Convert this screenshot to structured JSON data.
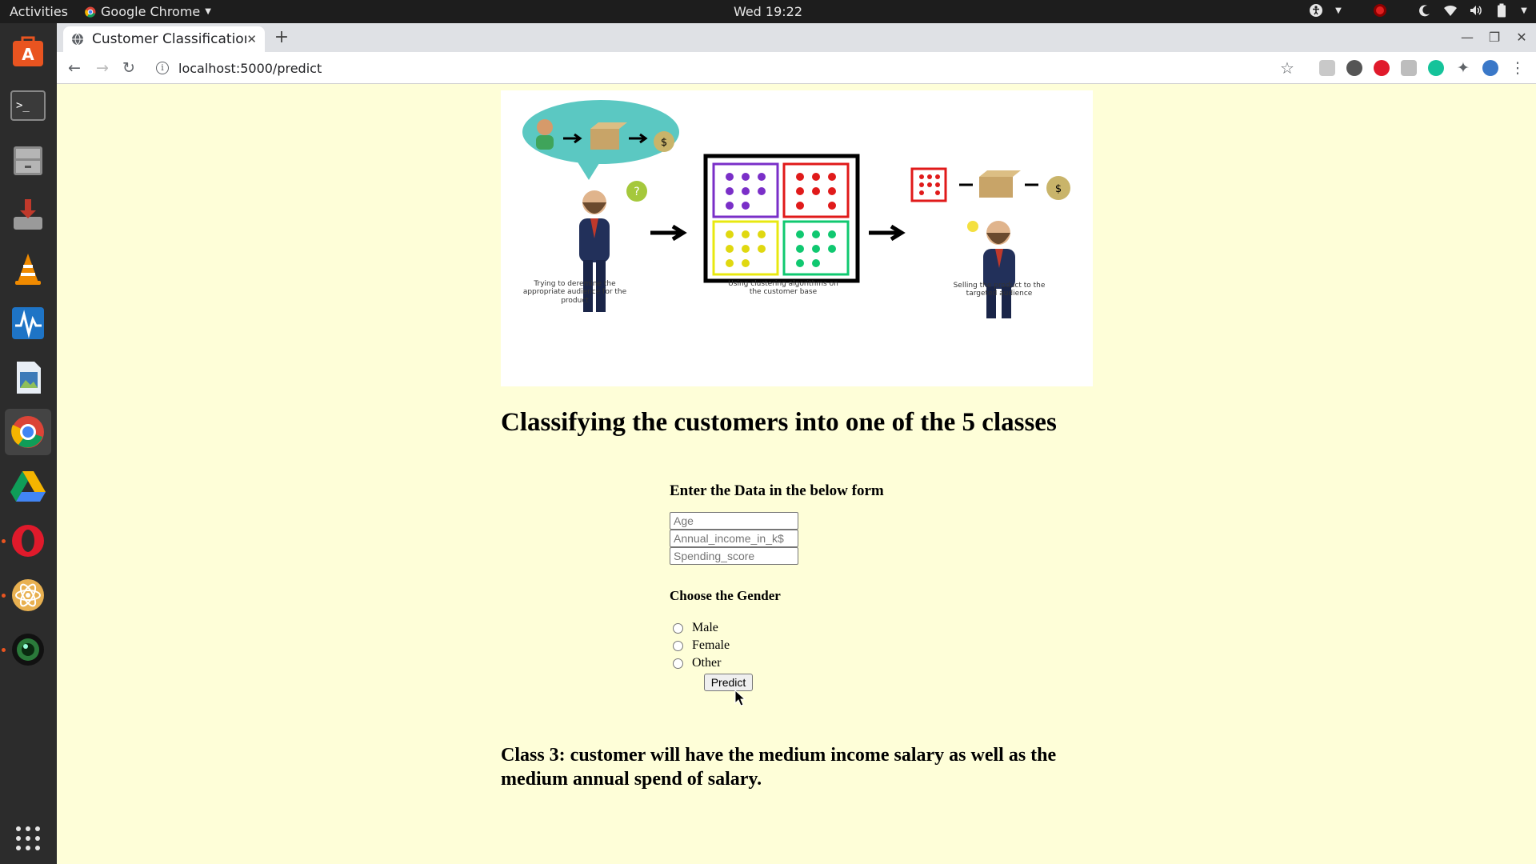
{
  "topbar": {
    "activities": "Activities",
    "app_name": "Google Chrome",
    "clock": "Wed 19:22"
  },
  "browser": {
    "tab_title": "Customer Classification",
    "url": "localhost:5000/predict"
  },
  "hero": {
    "caption_1": "Trying to deremine the appropriate audience for the product",
    "caption_2": "Using clustering algorithms on the customer base",
    "caption_3": "Selling the product to the targeted audience"
  },
  "page": {
    "heading": "Classifying the customers into one of the 5 classes",
    "form_title": "Enter the Data in the below form",
    "inputs": [
      {
        "placeholder": "Age",
        "value": ""
      },
      {
        "placeholder": "Annual_income_in_k$",
        "value": ""
      },
      {
        "placeholder": "Spending_score",
        "value": ""
      }
    ],
    "gender_title": "Choose the Gender",
    "gender_options": [
      "Male",
      "Female",
      "Other"
    ],
    "predict_label": "Predict",
    "result": "Class 3: customer will have the medium income salary as well as the medium annual spend of salary."
  }
}
